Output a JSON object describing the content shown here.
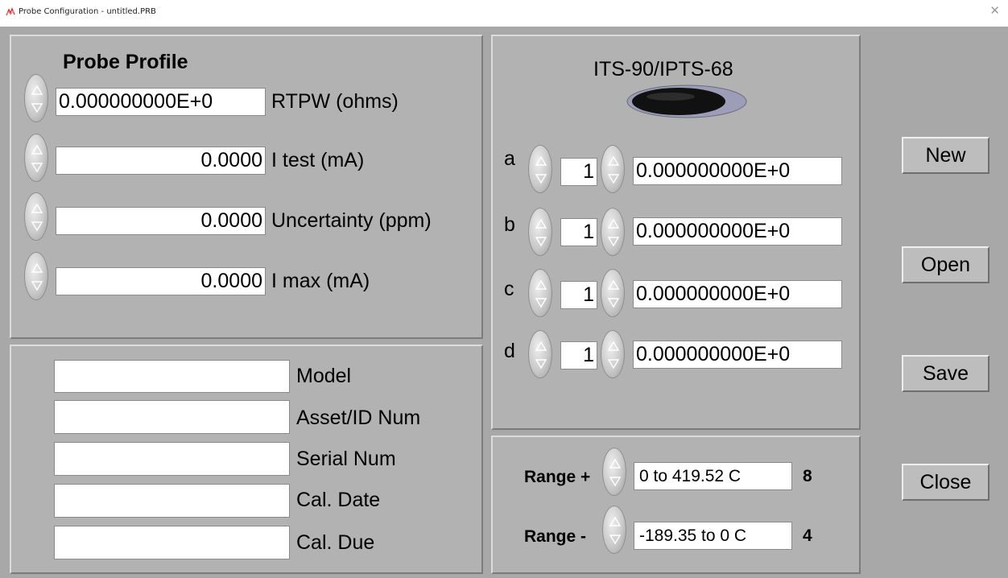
{
  "window": {
    "title": "Probe Configuration - untitled.PRB",
    "close_icon": "close-icon"
  },
  "profile": {
    "heading": "Probe Profile",
    "rows": [
      {
        "value": "0.000000000E+0",
        "label": "RTPW (ohms)"
      },
      {
        "value": "0.0000",
        "label": "I test (mA)"
      },
      {
        "value": "0.0000",
        "label": "Uncertainty (ppm)"
      },
      {
        "value": "0.0000",
        "label": "I max (mA)"
      }
    ]
  },
  "info": {
    "fields": [
      {
        "label": "Model",
        "value": ""
      },
      {
        "label": "Asset/ID Num",
        "value": ""
      },
      {
        "label": "Serial Num",
        "value": ""
      },
      {
        "label": "Cal. Date",
        "value": ""
      },
      {
        "label": "Cal. Due",
        "value": ""
      }
    ]
  },
  "coefficients": {
    "heading": "ITS-90/IPTS-68",
    "rows": [
      {
        "letter": "a",
        "index": "1",
        "value": "0.000000000E+0"
      },
      {
        "letter": "b",
        "index": "1",
        "value": "0.000000000E+0"
      },
      {
        "letter": "c",
        "index": "1",
        "value": "0.000000000E+0"
      },
      {
        "letter": "d",
        "index": "1",
        "value": "0.000000000E+0"
      }
    ]
  },
  "range": {
    "plus": {
      "label": "Range +",
      "value": "0 to 419.52 C",
      "count": "8"
    },
    "minus": {
      "label": "Range -",
      "value": "-189.35 to 0 C",
      "count": "4"
    }
  },
  "buttons": {
    "new": "New",
    "open": "Open",
    "save": "Save",
    "close": "Close"
  },
  "colors": {
    "background": "#a8a8a8",
    "panel": "#b2b2b2",
    "led_off": "#111111"
  }
}
